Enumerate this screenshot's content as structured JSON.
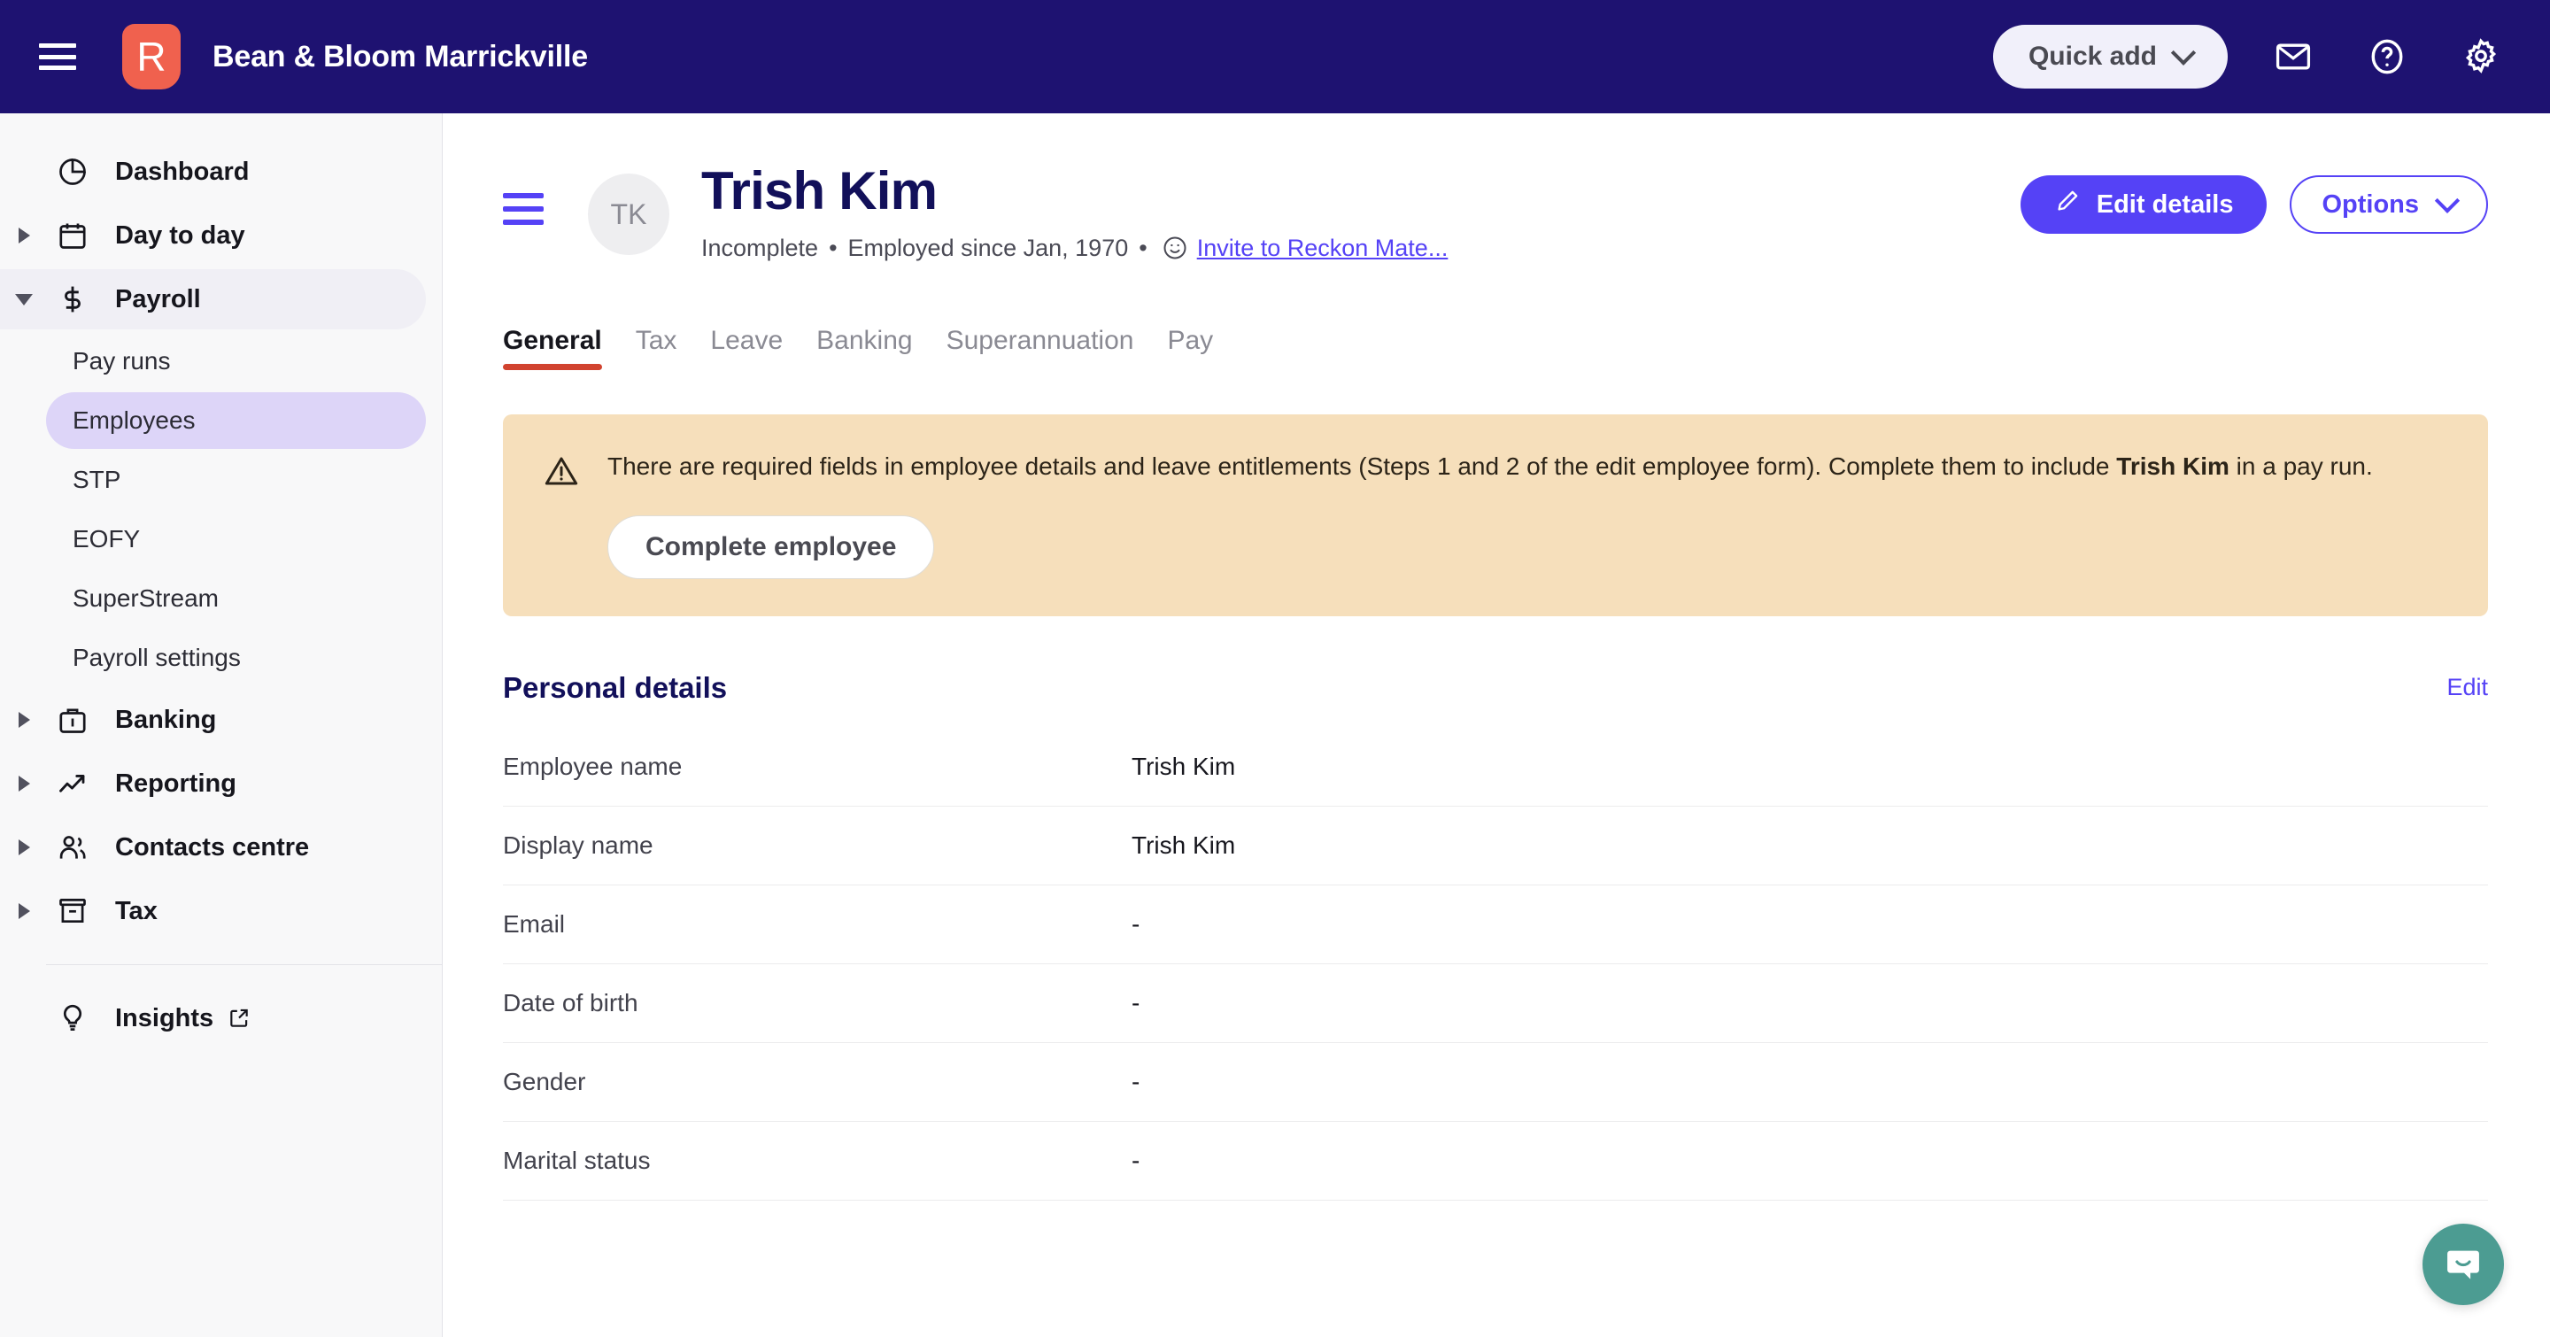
{
  "topnav": {
    "menu_icon": "hamburger-icon",
    "logo_letter": "R",
    "company_name": "Bean & Bloom Marrickville",
    "quick_add_label": "Quick add",
    "icons": [
      "mail-icon",
      "help-icon",
      "gear-icon"
    ],
    "brand_color": "#1e1271",
    "logo_color": "#f0614e"
  },
  "sidebar": {
    "items": [
      {
        "label": "Dashboard",
        "icon": "pie-chart-icon",
        "expandable": false
      },
      {
        "label": "Day to day",
        "icon": "calendar-icon",
        "expandable": true,
        "expanded": false
      },
      {
        "label": "Payroll",
        "icon": "dollar-icon",
        "expandable": true,
        "expanded": true
      }
    ],
    "payroll_children": [
      {
        "label": "Pay runs",
        "selected": false
      },
      {
        "label": "Employees",
        "selected": true
      },
      {
        "label": "STP",
        "selected": false
      },
      {
        "label": "EOFY",
        "selected": false
      },
      {
        "label": "SuperStream",
        "selected": false
      },
      {
        "label": "Payroll settings",
        "selected": false
      }
    ],
    "items_after": [
      {
        "label": "Banking",
        "icon": "briefcase-icon",
        "expandable": true
      },
      {
        "label": "Reporting",
        "icon": "trend-up-icon",
        "expandable": true
      },
      {
        "label": "Contacts centre",
        "icon": "users-icon",
        "expandable": true
      },
      {
        "label": "Tax",
        "icon": "archive-icon",
        "expandable": true
      }
    ],
    "footer_item": {
      "label": "Insights",
      "icon": "lightbulb-icon",
      "external": true
    },
    "selected_color": "#ddd5f8"
  },
  "page": {
    "menu_icon": "page-menu-icon",
    "avatar_initials": "TK",
    "employee_name": "Trish Kim",
    "status": "Incomplete",
    "meta_separator": "•",
    "employed_since": "Employed since Jan, 1970",
    "invite_icon": "smiley-icon",
    "invite_link": "Invite to Reckon Mate...",
    "edit_details_label": "Edit details",
    "edit_icon": "pencil-icon",
    "options_label": "Options",
    "accent_color": "#5542f6",
    "title_color": "#12105a"
  },
  "tabs": [
    {
      "label": "General",
      "active": true
    },
    {
      "label": "Tax",
      "active": false
    },
    {
      "label": "Leave",
      "active": false
    },
    {
      "label": "Banking",
      "active": false
    },
    {
      "label": "Superannuation",
      "active": false
    },
    {
      "label": "Pay",
      "active": false
    }
  ],
  "tab_underline_color": "#d1432f",
  "alert": {
    "icon": "warning-triangle-icon",
    "text_part1": "There are required fields in employee details and leave entitlements (Steps 1 and 2 of the edit employee form). Complete them to include ",
    "highlight": "Trish Kim",
    "text_part2": " in a pay run.",
    "button_label": "Complete employee",
    "background_color": "#f6dfbb"
  },
  "personal_details": {
    "title": "Personal details",
    "edit_label": "Edit",
    "rows": [
      {
        "label": "Employee name",
        "value": "Trish Kim"
      },
      {
        "label": "Display name",
        "value": "Trish Kim"
      },
      {
        "label": "Email",
        "value": "-"
      },
      {
        "label": "Date of birth",
        "value": "-"
      },
      {
        "label": "Gender",
        "value": "-"
      },
      {
        "label": "Marital status",
        "value": "-"
      }
    ]
  },
  "chat": {
    "icon": "chat-bubble-icon",
    "color": "#4c9c92"
  }
}
